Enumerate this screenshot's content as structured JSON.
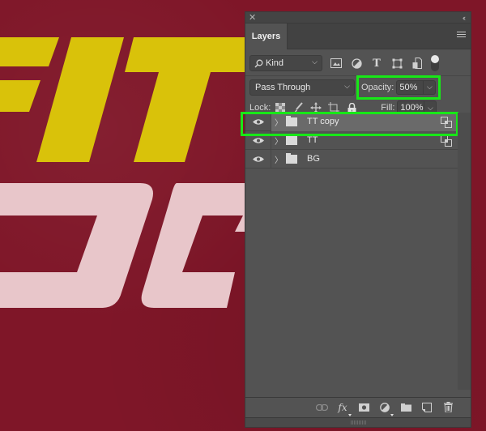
{
  "canvas": {
    "artwork_text_line1": "FIT",
    "artwork_text_line2": "OG",
    "background_color": "#7f1628",
    "yellow_color": "#d9c20a",
    "pink_color": "#e8c6ca"
  },
  "panel": {
    "close_icon": "close-icon",
    "collapse_icon": "double-chevron-left-icon",
    "tab_label": "Layers",
    "menu_icon": "hamburger-menu-icon",
    "filter": {
      "kind_label": "Kind",
      "icons": [
        "image-filter-icon",
        "adjustment-filter-icon",
        "type-filter-icon",
        "shape-filter-icon",
        "smart-object-filter-icon"
      ],
      "toggle": "filter-toggle"
    },
    "blend_mode": "Pass Through",
    "opacity_label": "Opacity:",
    "opacity_value": "50%",
    "lock_label": "Lock:",
    "lock_icons": [
      "lock-transparent-pixels-icon",
      "lock-image-pixels-icon",
      "lock-position-icon",
      "lock-artboard-icon",
      "lock-all-icon"
    ],
    "fill_label": "Fill:",
    "fill_value": "100%",
    "layers": [
      {
        "name": "TT copy",
        "type": "group",
        "visible": true,
        "selected": true,
        "linked": true
      },
      {
        "name": "TT",
        "type": "group",
        "visible": true,
        "selected": false,
        "linked": true
      },
      {
        "name": "BG",
        "type": "group",
        "visible": true,
        "selected": false,
        "linked": false
      }
    ],
    "bottom_icons": [
      "link-layers-icon",
      "fx-icon",
      "add-mask-icon",
      "adjustment-layer-icon",
      "new-group-icon",
      "new-layer-icon",
      "delete-icon"
    ]
  },
  "highlight_color": "#17e817"
}
